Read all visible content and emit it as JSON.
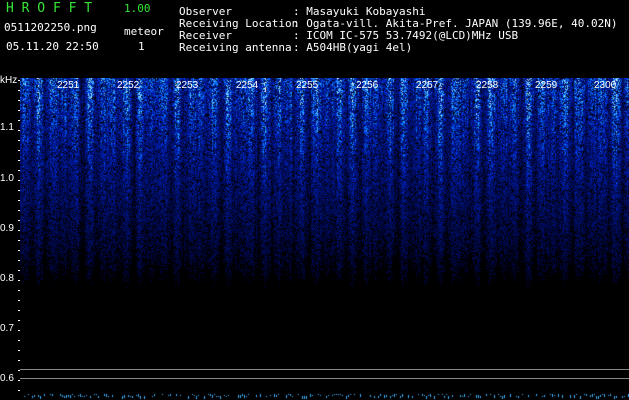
{
  "header": {
    "app_title": "H R O F F T",
    "version": "1.00",
    "filename": "0511202250.png",
    "datetime": "05.11.20 22:50",
    "meteor_label": "meteor",
    "meteor_count": "1",
    "fields": [
      {
        "label": "Observer",
        "value": ": Masayuki Kobayashi"
      },
      {
        "label": "Receiving Location",
        "value": ": Ogata-vill. Akita-Pref. JAPAN (139.96E, 40.02N)"
      },
      {
        "label": "Receiver",
        "value": ": ICOM IC-575 53.7492(@LCD)MHz USB"
      },
      {
        "label": "Receiving antenna",
        "value": ": A504HB(yagi 4el)"
      }
    ]
  },
  "spectrogram": {
    "y_unit": "kHz",
    "y_labels": [
      "1.1",
      "1.0",
      "0.9",
      "0.8",
      "0.7",
      "0.6"
    ],
    "time_labels": [
      "2251",
      "2252",
      "2253",
      "2254",
      "2255",
      "2256",
      "2257",
      "2258",
      "2259",
      "2300"
    ],
    "colors": {
      "signal": "#2f5cff",
      "bright": "#9fd0ff",
      "background": "#000000"
    }
  }
}
